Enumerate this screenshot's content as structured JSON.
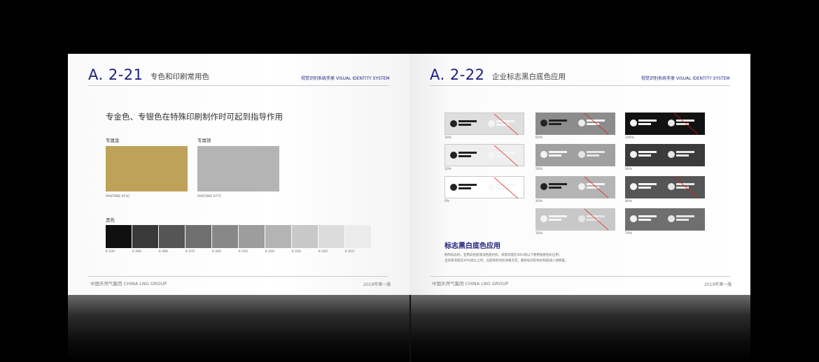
{
  "left_page": {
    "section_number": "A. 2-21",
    "section_title": "专色和印刷常用色",
    "header_right": "视觉识别系统手册 VISUAL IDENTITY SYSTEM",
    "heading": "专金色、专银色在特殊印刷制作时可起到指导作用",
    "gold": {
      "label": "专属金",
      "code": "PANTONE 874C",
      "color": "#bfa25a"
    },
    "silver": {
      "label": "专属银",
      "code": "PANTONE 877C",
      "color": "#b4b4b4"
    },
    "black": {
      "label": "黑色",
      "swatches": [
        {
          "code": "K 100",
          "color": "#101010"
        },
        {
          "code": "K 090",
          "color": "#3a3939"
        },
        {
          "code": "K 080",
          "color": "#565555"
        },
        {
          "code": "K 070",
          "color": "#6f6f6f"
        },
        {
          "code": "K 060",
          "color": "#888888"
        },
        {
          "code": "K 050",
          "color": "#9d9d9d"
        },
        {
          "code": "K 040",
          "color": "#b4b4b4"
        },
        {
          "code": "K 030",
          "color": "#c8c8c8"
        },
        {
          "code": "K 020",
          "color": "#dcdcdc"
        },
        {
          "code": "K 010",
          "color": "#ececec"
        }
      ]
    },
    "footer_left": "中国天然气集团  CHINA LNG GROUP",
    "footer_right": "2019年第一版"
  },
  "right_page": {
    "section_number": "A. 2-22",
    "section_title": "企业标志黑白底色应用",
    "header_right": "视觉识别系统手册 VISUAL IDENTITY SYSTEM",
    "columns": [
      [
        {
          "pct": "20%",
          "bg": "#dedede",
          "ink": "dark",
          "forbidden": true
        },
        {
          "pct": "10%",
          "bg": "#eeeeee",
          "ink": "dark",
          "forbidden": true
        },
        {
          "pct": "0%",
          "bg": "#ffffff",
          "ink": "dark",
          "forbidden": true
        }
      ],
      [
        {
          "pct": "60%",
          "bg": "#8c8c8c",
          "ink": "dark",
          "forbidden": true
        },
        {
          "pct": "50%",
          "bg": "#a0a0a0",
          "ink": "light",
          "forbidden": false
        },
        {
          "pct": "40%",
          "bg": "#b4b4b4",
          "ink": "dark",
          "forbidden": true
        },
        {
          "pct": "30%",
          "bg": "#c8c8c8",
          "ink": "light",
          "forbidden": true
        }
      ],
      [
        {
          "pct": "100%",
          "bg": "#121212",
          "ink": "light",
          "forbidden": true
        },
        {
          "pct": "90%",
          "bg": "#3b3b3b",
          "ink": "light",
          "forbidden": false
        },
        {
          "pct": "80%",
          "bg": "#565656",
          "ink": "light",
          "forbidden": true
        },
        {
          "pct": "70%",
          "bg": "#6f6f6f",
          "ink": "light",
          "forbidden": false
        }
      ]
    ],
    "usage_title": "标志黑白底色应用",
    "usage_text_1": "制作标志时，宜用白色底或浅色底衬托，背景深度在40%黑以下使用纸底色彩应用；",
    "usage_text_2": "当背景深度在40%黑以上时，与底色的对比效果方佳，图形标识的色彩和底减少透明度。",
    "footer_left": "中国天然气集团  CHINA LNG GROUP",
    "footer_right": "2019年第一版"
  }
}
